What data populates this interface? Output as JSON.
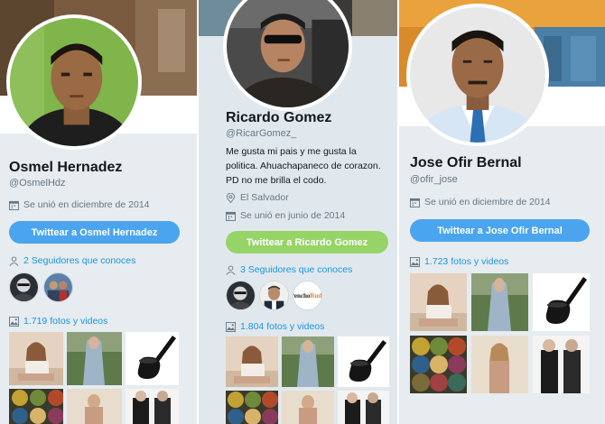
{
  "profiles": [
    {
      "name": "Osmel Hernadez",
      "handle": "@OsmelHdz",
      "joined": "Se unió en diciembre de 2014",
      "tweet_button": "Twittear a Osmel Hernadez",
      "followers_known": "2 Seguidores que conoces",
      "photos_videos": "1.719 fotos y videos",
      "follower_avatars": [
        "dark-sunglasses-avatar",
        "group-photo-avatar"
      ]
    },
    {
      "name": "Ricardo Gomez",
      "handle": "@RicarGomez_",
      "bio": "Me gusta mi pais y me gusta la politica. Ahuachapaneco de corazon. PD no me brilla el codo.",
      "location": "El Salvador",
      "joined": "Se unió en junio de 2014",
      "tweet_button": "Twittear a Ricardo Gomez",
      "followers_known": "3 Seguidores que conoces",
      "photos_videos": "1.804 fotos y videos",
      "follower_avatars": [
        "dark-sunglasses-avatar",
        "man-portrait-avatar",
        "logo-avatar"
      ],
      "logo_text": "Pencho",
      "logo_text_accent": "Rude"
    },
    {
      "name": "Jose Ofir Bernal",
      "handle": "@ofir_jose",
      "joined": "Se unió en diciembre de 2014",
      "tweet_button": "Twittear a Jose Ofir Bernal",
      "photos_videos": "1.723 fotos y videos"
    }
  ],
  "colors": {
    "link_blue": "#1b95e0",
    "button_blue": "#4aa5ee",
    "button_green": "#96d468",
    "muted_text": "#657786",
    "panel_bg": "#e6ecf0"
  }
}
